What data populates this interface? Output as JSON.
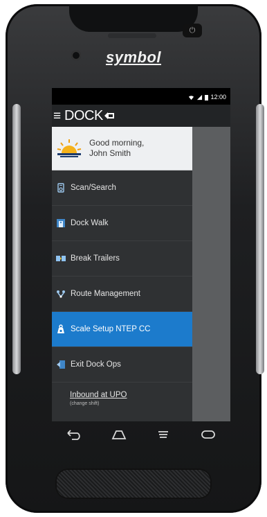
{
  "device": {
    "brand": "symbol"
  },
  "statusbar": {
    "time": "12:00"
  },
  "appbar": {
    "title": "DOCK"
  },
  "greeting": {
    "line1": "Good morning,",
    "line2": "John Smith"
  },
  "menu": {
    "items": [
      {
        "label": "Scan/Search",
        "icon": "scan-icon"
      },
      {
        "label": "Dock Walk",
        "icon": "dock-walk-icon"
      },
      {
        "label": "Break Trailers",
        "icon": "break-trailers-icon"
      },
      {
        "label": "Route Management",
        "icon": "route-icon"
      },
      {
        "label": "Scale Setup NTEP CC",
        "icon": "scale-icon"
      },
      {
        "label": "Exit Dock Ops",
        "icon": "exit-icon"
      }
    ],
    "active_index": 4
  },
  "shift": {
    "title": "Inbound at UPO",
    "subtitle": "(change shift)"
  },
  "colors": {
    "accent": "#1c7bcc",
    "drawer": "#2f3133",
    "appbar": "#222426"
  }
}
